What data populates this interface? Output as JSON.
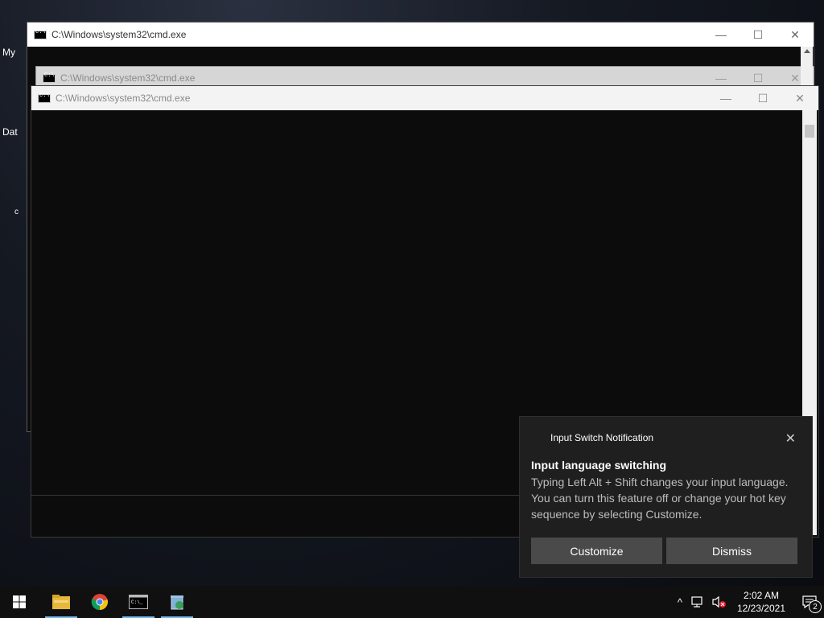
{
  "desktop": {
    "icons": [
      {
        "label": "My"
      },
      {
        "label": "Dat"
      },
      {
        "label": "c"
      }
    ]
  },
  "windows": [
    {
      "title": "C:\\Windows\\system32\\cmd.exe"
    },
    {
      "title": "C:\\Windows\\system32\\cmd.exe"
    },
    {
      "title": "C:\\Windows\\system32\\cmd.exe"
    }
  ],
  "titlebar_buttons": {
    "minimize": "—",
    "maximize": "☐",
    "close": "✕"
  },
  "notification": {
    "app_title": "Input Switch Notification",
    "close_glyph": "✕",
    "heading": "Input language switching",
    "body": "Typing Left Alt + Shift changes your input language. You can turn this feature off or change your hot key sequence by selecting Customize.",
    "buttons": {
      "customize": "Customize",
      "dismiss": "Dismiss"
    }
  },
  "taskbar": {
    "start_icon": "windows-logo-icon",
    "apps": [
      {
        "name": "file-explorer-icon"
      },
      {
        "name": "chrome-icon"
      },
      {
        "name": "command-prompt-icon"
      },
      {
        "name": "recycle-app-icon"
      }
    ],
    "tray": {
      "chevron": "^",
      "time": "2:02 AM",
      "date": "12/23/2021",
      "notification_count": "2"
    }
  }
}
